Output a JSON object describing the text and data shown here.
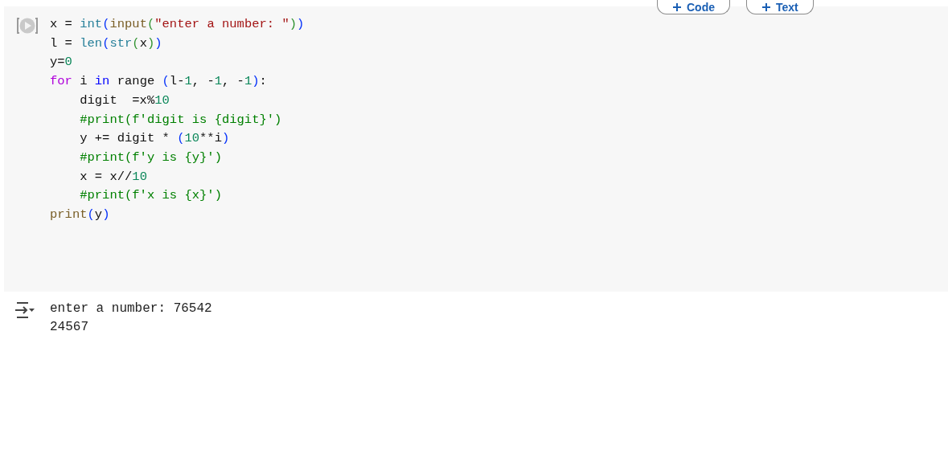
{
  "toolbar": {
    "buttons": [
      {
        "label": "Code"
      },
      {
        "label": "Text"
      }
    ]
  },
  "code_cell": {
    "lines": [
      [
        {
          "text": "x = ",
          "kind": "plain"
        },
        {
          "text": "int",
          "kind": "type"
        },
        {
          "text": "(",
          "kind": "p1"
        },
        {
          "text": "input",
          "kind": "func"
        },
        {
          "text": "(",
          "kind": "p2"
        },
        {
          "text": "\"enter a number: \"",
          "kind": "string"
        },
        {
          "text": ")",
          "kind": "p2"
        },
        {
          "text": ")",
          "kind": "p1"
        }
      ],
      [
        {
          "text": "l = ",
          "kind": "plain"
        },
        {
          "text": "len",
          "kind": "type"
        },
        {
          "text": "(",
          "kind": "p1"
        },
        {
          "text": "str",
          "kind": "type"
        },
        {
          "text": "(",
          "kind": "p2"
        },
        {
          "text": "x",
          "kind": "plain"
        },
        {
          "text": ")",
          "kind": "p2"
        },
        {
          "text": ")",
          "kind": "p1"
        }
      ],
      [
        {
          "text": "y=",
          "kind": "plain"
        },
        {
          "text": "0",
          "kind": "number"
        }
      ],
      [
        {
          "text": "for",
          "kind": "keyword"
        },
        {
          "text": " i ",
          "kind": "plain"
        },
        {
          "text": "in",
          "kind": "operator"
        },
        {
          "text": " range ",
          "kind": "plain"
        },
        {
          "text": "(",
          "kind": "p1"
        },
        {
          "text": "l-",
          "kind": "plain"
        },
        {
          "text": "1",
          "kind": "number"
        },
        {
          "text": ", -",
          "kind": "plain"
        },
        {
          "text": "1",
          "kind": "number"
        },
        {
          "text": ", -",
          "kind": "plain"
        },
        {
          "text": "1",
          "kind": "number"
        },
        {
          "text": ")",
          "kind": "p1"
        },
        {
          "text": ":",
          "kind": "plain"
        }
      ],
      [
        {
          "text": "    digit  =x%",
          "kind": "plain"
        },
        {
          "text": "10",
          "kind": "number"
        }
      ],
      [
        {
          "text": "    #print(f'digit is {digit}')",
          "kind": "comment"
        }
      ],
      [
        {
          "text": "    y += digit * ",
          "kind": "plain"
        },
        {
          "text": "(",
          "kind": "p1"
        },
        {
          "text": "10",
          "kind": "number"
        },
        {
          "text": "**i",
          "kind": "plain"
        },
        {
          "text": ")",
          "kind": "p1"
        }
      ],
      [
        {
          "text": "    #print(f'y is {y}')",
          "kind": "comment"
        }
      ],
      [
        {
          "text": "    x = x//",
          "kind": "plain"
        },
        {
          "text": "10",
          "kind": "number"
        }
      ],
      [
        {
          "text": "    #print(f'x is {x}')",
          "kind": "comment"
        }
      ],
      [
        {
          "text": "print",
          "kind": "func"
        },
        {
          "text": "(",
          "kind": "p1"
        },
        {
          "text": "y",
          "kind": "plain"
        },
        {
          "text": ")",
          "kind": "p1"
        }
      ]
    ]
  },
  "output": {
    "lines": [
      "enter a number: 76542",
      "24567"
    ]
  }
}
